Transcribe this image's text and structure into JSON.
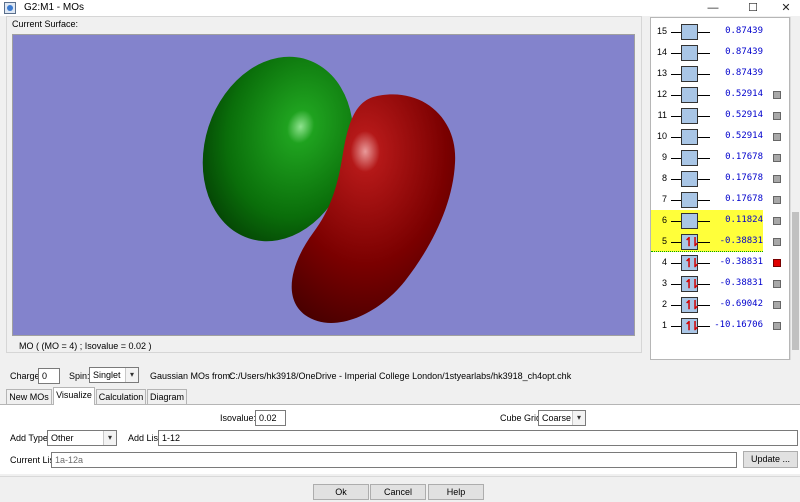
{
  "window": {
    "title": "G2:M1 - MOs",
    "minimize": "—",
    "maximize": "☐",
    "close": "✕"
  },
  "surface": {
    "label": "Current Surface:",
    "status": "MO ( (MO = 4) ; Isovalue = 0.02 )",
    "background_color": "#8383cc",
    "lobe_colors": {
      "positive": "#0b7a0b",
      "negative": "#7d0000"
    }
  },
  "mo_list": [
    {
      "num": "15",
      "energy": "0.87439",
      "occupied": false,
      "highlight": false,
      "square": false,
      "selected": false
    },
    {
      "num": "14",
      "energy": "0.87439",
      "occupied": false,
      "highlight": false,
      "square": false,
      "selected": false
    },
    {
      "num": "13",
      "energy": "0.87439",
      "occupied": false,
      "highlight": false,
      "square": false,
      "selected": false
    },
    {
      "num": "12",
      "energy": "0.52914",
      "occupied": false,
      "highlight": false,
      "square": true,
      "selected": false
    },
    {
      "num": "11",
      "energy": "0.52914",
      "occupied": false,
      "highlight": false,
      "square": true,
      "selected": false
    },
    {
      "num": "10",
      "energy": "0.52914",
      "occupied": false,
      "highlight": false,
      "square": true,
      "selected": false
    },
    {
      "num": "9",
      "energy": "0.17678",
      "occupied": false,
      "highlight": false,
      "square": true,
      "selected": false
    },
    {
      "num": "8",
      "energy": "0.17678",
      "occupied": false,
      "highlight": false,
      "square": true,
      "selected": false
    },
    {
      "num": "7",
      "energy": "0.17678",
      "occupied": false,
      "highlight": false,
      "square": true,
      "selected": false
    },
    {
      "num": "6",
      "energy": "0.11824",
      "occupied": false,
      "highlight": true,
      "square": true,
      "selected": false
    },
    {
      "num": "5",
      "energy": "-0.38831",
      "occupied": true,
      "highlight": true,
      "square": true,
      "selected": false
    },
    {
      "num": "4",
      "energy": "-0.38831",
      "occupied": true,
      "highlight": false,
      "square": true,
      "selected": true
    },
    {
      "num": "3",
      "energy": "-0.38831",
      "occupied": true,
      "highlight": false,
      "square": true,
      "selected": false
    },
    {
      "num": "2",
      "energy": "-0.69042",
      "occupied": true,
      "highlight": false,
      "square": true,
      "selected": false
    },
    {
      "num": "1",
      "energy": "-10.16706",
      "occupied": true,
      "highlight": false,
      "square": true,
      "selected": false
    }
  ],
  "charge": {
    "label": "Charge:",
    "value": "0"
  },
  "spin": {
    "label": "Spin:",
    "value": "Singlet"
  },
  "source": {
    "label": "Gaussian MOs from:",
    "path": "C:/Users/hk3918/OneDrive - Imperial College London/1styearlabs/hk3918_ch4opt.chk"
  },
  "tabs": [
    "New MOs",
    "Visualize",
    "Calculation",
    "Diagram"
  ],
  "active_tab": "Visualize",
  "visualize": {
    "isovalue_label": "Isovalue:",
    "isovalue": "0.02",
    "cube_grid_label": "Cube Grid:",
    "cube_grid": "Coarse",
    "add_type_label": "Add Type:",
    "add_type": "Other",
    "add_list_label": "Add List:",
    "add_list": "1-12",
    "current_list_label": "Current List:",
    "current_list": "1a-12a",
    "update_button": "Update ..."
  },
  "buttons": {
    "ok": "Ok",
    "cancel": "Cancel",
    "help": "Help"
  }
}
